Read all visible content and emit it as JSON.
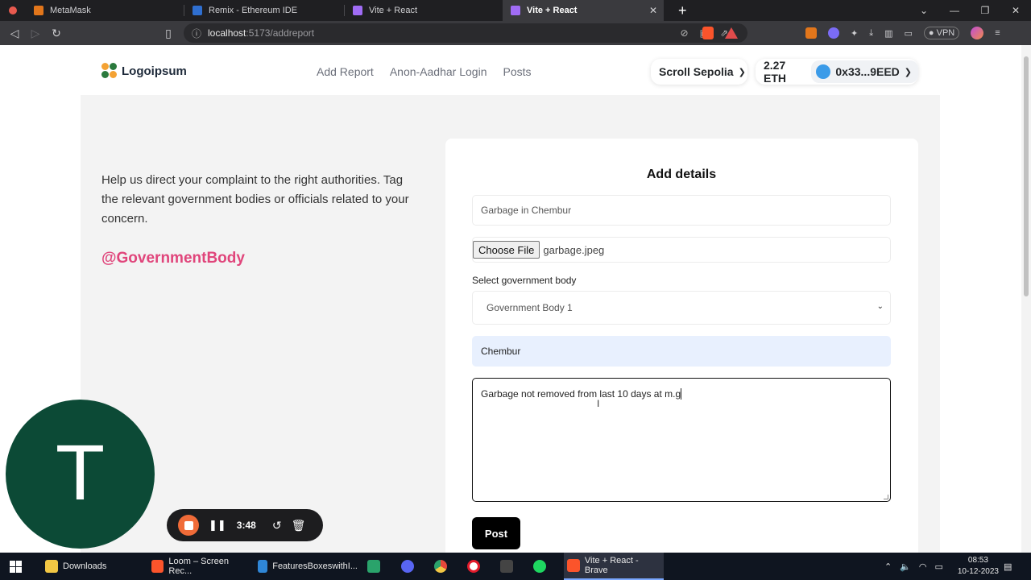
{
  "browser": {
    "tabs": [
      {
        "label": "MetaMask",
        "active": false,
        "favicon_color": "#e2761b"
      },
      {
        "label": "Remix - Ethereum IDE",
        "active": false,
        "favicon_color": "#2f6fd0"
      },
      {
        "label": "Vite + React",
        "active": false,
        "favicon_color": "#a06cf5"
      },
      {
        "label": "Vite + React",
        "active": true,
        "favicon_color": "#a06cf5"
      }
    ],
    "url_host": "localhost",
    "url_path": ":5173/addreport",
    "vpn_label": "VPN"
  },
  "header": {
    "logo_text": "Logoipsum",
    "nav": [
      "Add Report",
      "Anon-Aadhar Login",
      "Posts"
    ],
    "network_label": "Scroll Sepolia",
    "balance": "2.27 ETH",
    "account": "0x33...9EED"
  },
  "intro": {
    "text": "Help us direct your complaint to the right authorities. Tag the relevant government bodies or officials related to your concern.",
    "tag": "@GovernmentBody"
  },
  "form": {
    "title": "Add details",
    "report_title_value": "Garbage in Chembur",
    "file_button": "Choose File",
    "file_name": "garbage.jpeg",
    "select_label": "Select government body",
    "select_value": "Government Body 1",
    "location_value": "Chembur",
    "description_value": "Garbage not removed from last 10 days at m.g",
    "submit_label": "Post"
  },
  "loom": {
    "avatar_letter": "T",
    "timer": "3:48"
  },
  "taskbar": {
    "items": [
      {
        "label": "Downloads",
        "color": "#f2c744"
      },
      {
        "label": "Loom – Screen Rec...",
        "color": "#fb542b"
      },
      {
        "label": "FeaturesBoxeswithI...",
        "color": "#2f86d6"
      },
      {
        "label": "",
        "color": "#2aa36b"
      },
      {
        "label": "",
        "color": "#5865f2"
      },
      {
        "label": "",
        "color": "#e5483a"
      },
      {
        "label": "",
        "color": "#e21b2b"
      },
      {
        "label": "",
        "color": "#444444"
      },
      {
        "label": "",
        "color": "#1ed760"
      },
      {
        "label": "Vite + React - Brave",
        "color": "#fb542b",
        "active": true
      }
    ],
    "time": "08:53",
    "date": "10-12-2023"
  },
  "colors": {
    "accent_tag": "#e0457b",
    "post_button": "#000000",
    "loom_avatar": "#0c4a36",
    "loom_stop": "#f06b38"
  }
}
